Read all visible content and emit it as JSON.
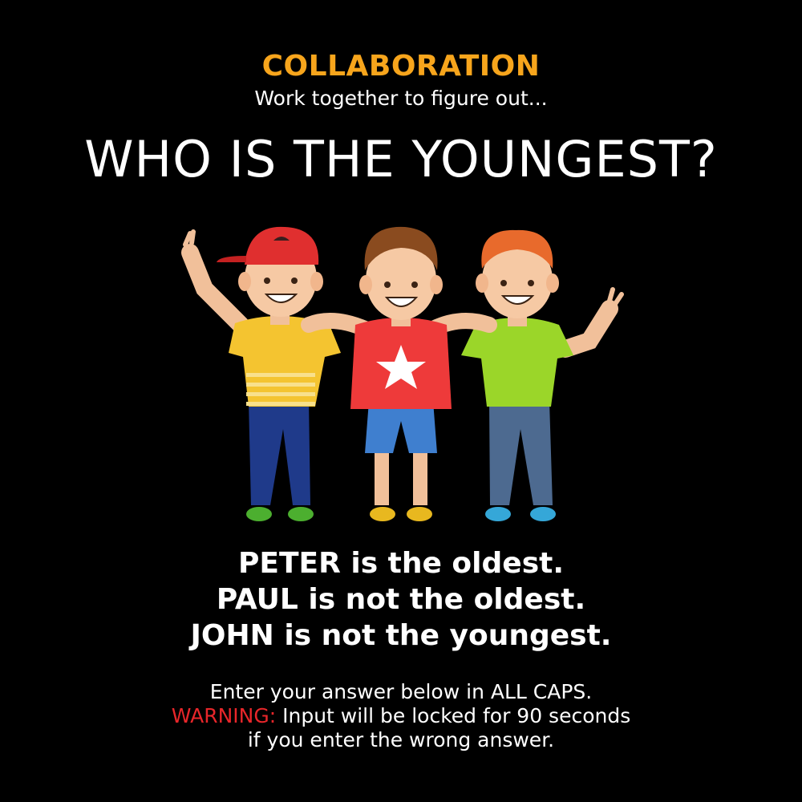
{
  "header": {
    "label": "COLLABORATION",
    "subtitle": "Work together to figure out...",
    "headline": "WHO IS THE YOUNGEST?"
  },
  "clues": [
    "PETER is the oldest.",
    "PAUL is not the oldest.",
    "JOHN is not the youngest."
  ],
  "instructions": {
    "line1": "Enter your answer below in ALL CAPS.",
    "warning_label": "WARNING:",
    "warning_text": " Input will be locked for 90 seconds",
    "line3": "if you enter the wrong answer."
  },
  "colors": {
    "background": "#000000",
    "accent": "#f7a51c",
    "warning": "#e8262a",
    "text": "#ffffff"
  },
  "illustration": {
    "subject": "three-boys-arm-in-arm"
  }
}
